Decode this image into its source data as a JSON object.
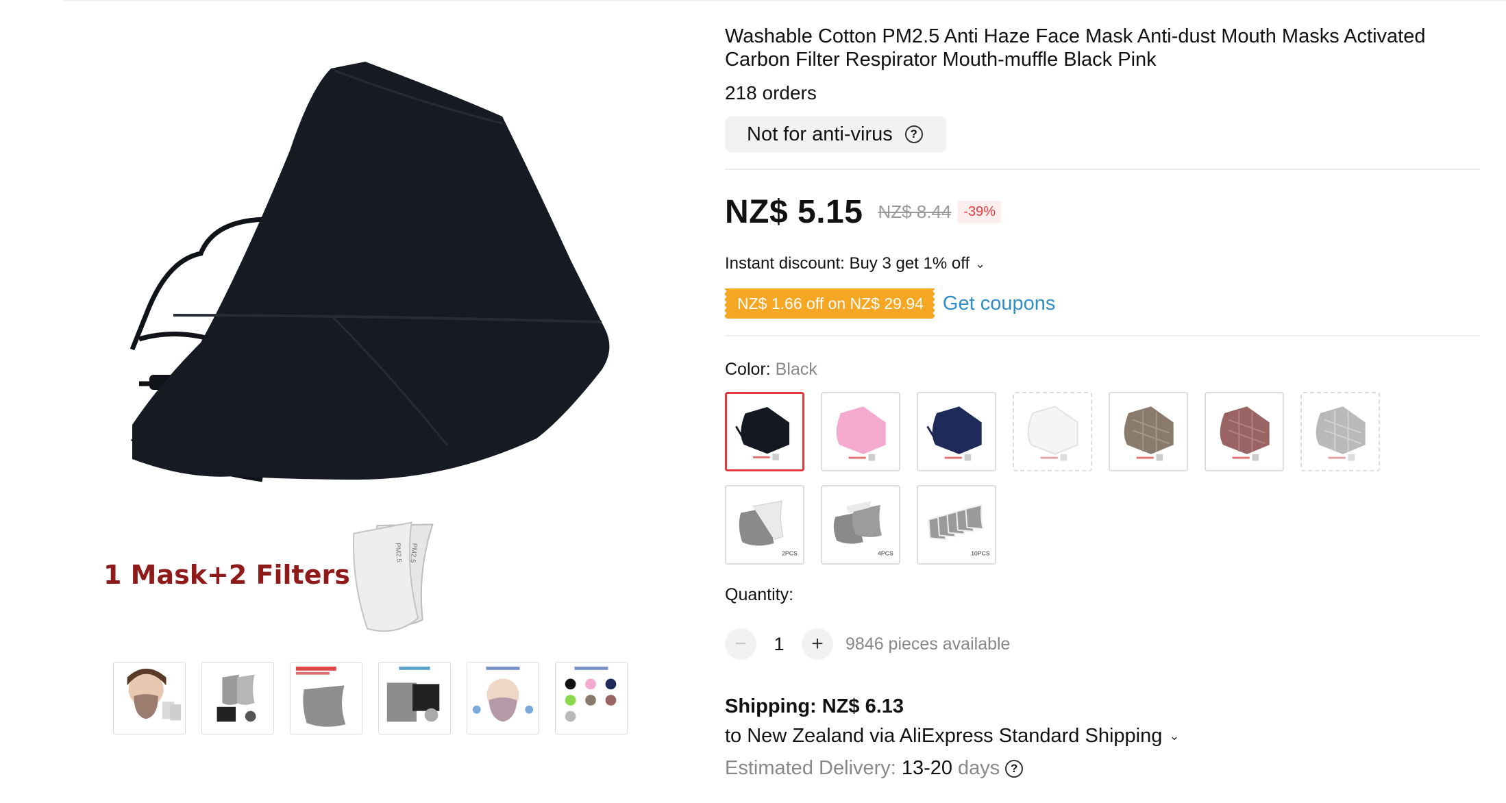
{
  "gallery": {
    "main_caption": "1 Mask+2 Filters",
    "filter_print": "PM2.5",
    "thumbnails": [
      "thumb-model",
      "thumb-filters",
      "thumb-carbon",
      "thumb-upgrade",
      "thumb-instruction",
      "thumb-colors"
    ]
  },
  "product": {
    "title": "Washable Cotton PM2.5 Anti Haze Face Mask Anti-dust Mouth Masks Activated Carbon Filter Respirator Mouth-muffle Black Pink",
    "orders": "218 orders",
    "note": "Not for anti-virus",
    "note_help": "?",
    "price": "NZ$ 5.15",
    "original_price": "NZ$ 8.44",
    "discount_percent": "-39%",
    "instant_discount": "Instant discount: Buy 3 get 1% off",
    "instant_chevron": "⌄",
    "coupon": "NZ$ 1.66 off on NZ$ 29.94",
    "get_coupons": "Get coupons"
  },
  "color": {
    "label": "Color:",
    "selected": "Black",
    "options": [
      {
        "name": "Black",
        "fill": "#141820"
      },
      {
        "name": "Pink",
        "fill": "#f4a9cf"
      },
      {
        "name": "Navy",
        "fill": "#1e2a5a"
      },
      {
        "name": "White",
        "fill": "#f4f4f4"
      },
      {
        "name": "Brown check",
        "fill": "#8a7a6c"
      },
      {
        "name": "Red check",
        "fill": "#9a6464"
      },
      {
        "name": "Grey check",
        "fill": "#b9b9b9"
      },
      {
        "name": "2PCS",
        "fill": "#8a8a8a"
      },
      {
        "name": "4PCS",
        "fill": "#8a8a8a"
      },
      {
        "name": "10PCS",
        "fill": "#8a8a8a"
      }
    ]
  },
  "quantity": {
    "label": "Quantity:",
    "minus": "−",
    "value": "1",
    "plus": "+",
    "available": "9846 pieces available"
  },
  "shipping": {
    "title": "Shipping: NZ$ 6.13",
    "to": "to New Zealand via AliExpress Standard Shipping",
    "to_chevron": "⌄",
    "delivery_label": "Estimated Delivery:",
    "delivery_value": "13-20",
    "delivery_unit": "days",
    "help": "?"
  }
}
